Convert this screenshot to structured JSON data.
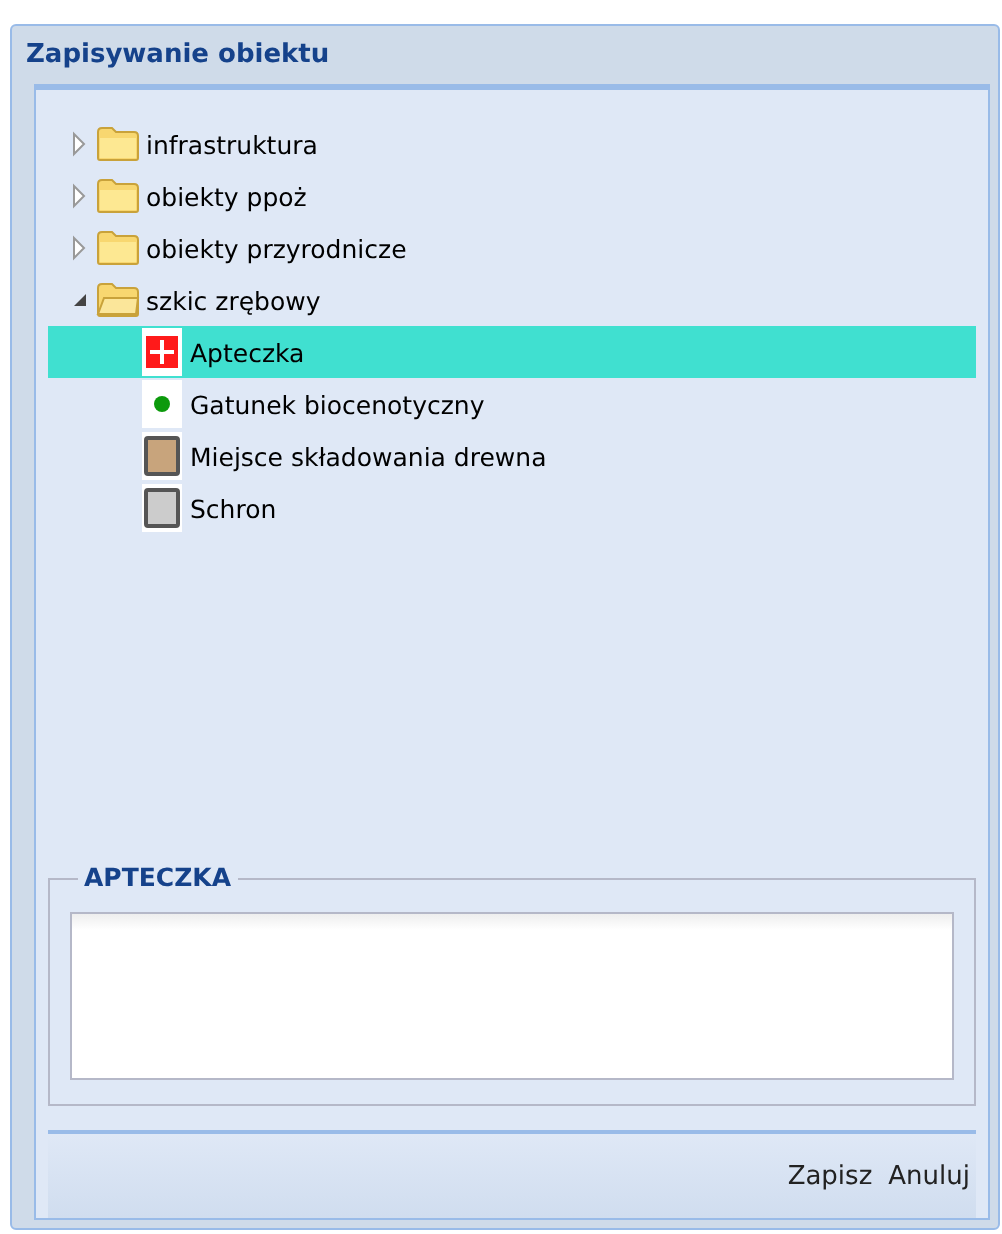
{
  "window": {
    "title": "Zapisywanie obiektu"
  },
  "tree": [
    {
      "label": "infrastruktura",
      "expanded": false,
      "selected": false
    },
    {
      "label": "obiekty ppoż",
      "expanded": false,
      "selected": false
    },
    {
      "label": "obiekty przyrodnicze",
      "expanded": false,
      "selected": false
    },
    {
      "label": "szkic zrębowy",
      "expanded": true,
      "selected": false,
      "children": [
        {
          "label": "Apteczka",
          "kind": "cross",
          "color": "#ff1a1a",
          "selected": true
        },
        {
          "label": "Gatunek biocenotyczny",
          "kind": "dot",
          "color": "#0c9a0c",
          "selected": false
        },
        {
          "label": "Miejsce składowania drewna",
          "kind": "square",
          "color": "#c8a47c",
          "selected": false
        },
        {
          "label": "Schron",
          "kind": "square",
          "color": "#cccccc",
          "selected": false
        }
      ]
    }
  ],
  "fieldset": {
    "legend": "APTECZKA"
  },
  "buttons": [
    "Zapisz",
    "Anuluj"
  ]
}
